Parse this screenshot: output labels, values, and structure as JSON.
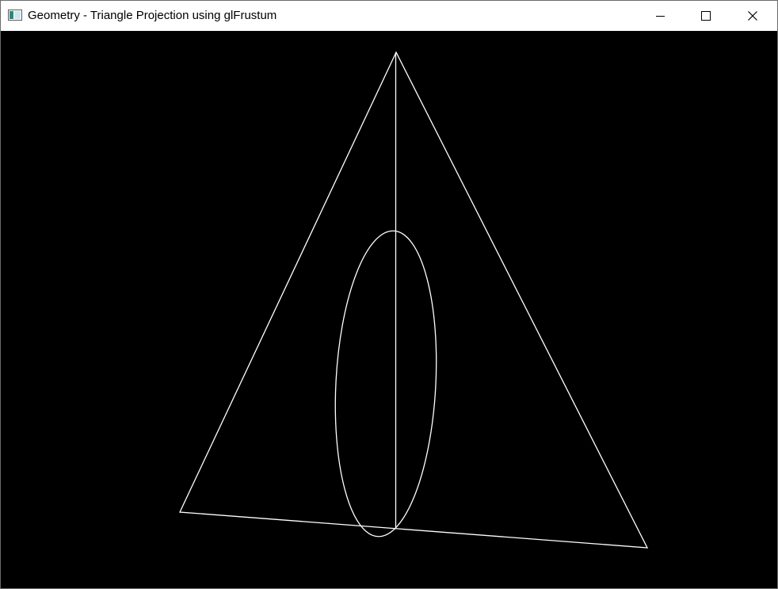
{
  "window": {
    "title": "Geometry - Triangle Projection using glFrustum",
    "app_icon": "window-app-icon",
    "controls": {
      "minimize": "minimize-icon",
      "maximize": "maximize-icon",
      "close": "close-icon"
    }
  },
  "scene": {
    "background_color": "#000000",
    "line_color": "#ffffff",
    "shapes": [
      "triangle",
      "ellipse",
      "vertical-line"
    ]
  }
}
